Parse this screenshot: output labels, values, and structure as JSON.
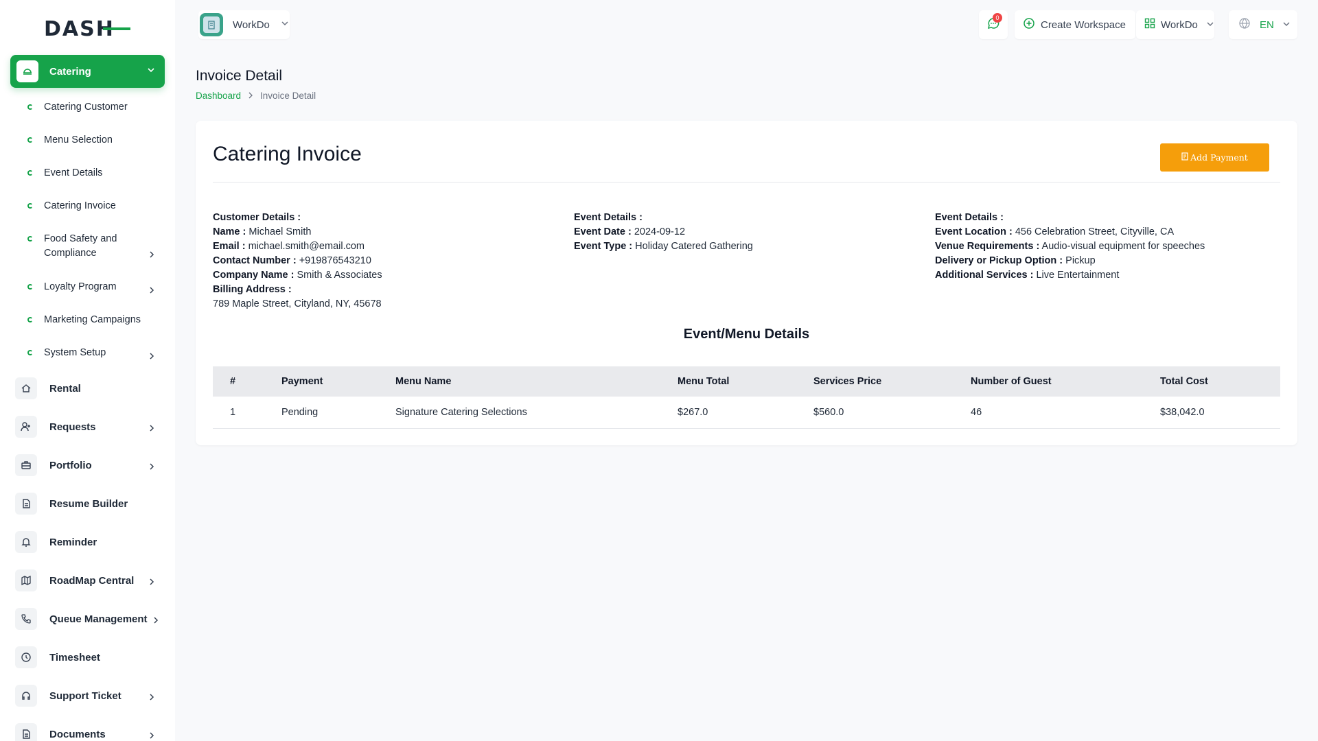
{
  "brand": {
    "logo_text": "DASH",
    "accent": "#16a34a"
  },
  "header": {
    "workspace_name": "WorkDo",
    "notification_count": "0",
    "create_workspace_label": "Create Workspace",
    "workspace_switch_label": "WorkDo",
    "language": "EN"
  },
  "sidebar": {
    "active_group": "Catering",
    "sub_items": [
      {
        "label": "Catering Customer"
      },
      {
        "label": "Menu Selection"
      },
      {
        "label": "Event Details"
      },
      {
        "label": "Catering Invoice"
      },
      {
        "label": "Food Safety and Compliance"
      },
      {
        "label": "Loyalty Program"
      },
      {
        "label": "Marketing Campaigns"
      },
      {
        "label": "System Setup"
      }
    ],
    "main_items": [
      {
        "label": "Rental"
      },
      {
        "label": "Requests"
      },
      {
        "label": "Portfolio"
      },
      {
        "label": "Resume Builder"
      },
      {
        "label": "Reminder"
      },
      {
        "label": "RoadMap Central"
      },
      {
        "label": "Queue Management"
      },
      {
        "label": "Timesheet"
      },
      {
        "label": "Support Ticket"
      },
      {
        "label": "Documents"
      }
    ]
  },
  "page": {
    "title": "Invoice Detail",
    "breadcrumb_home": "Dashboard",
    "breadcrumb_current": "Invoice Detail"
  },
  "invoice": {
    "title": "Catering Invoice",
    "add_payment_label": "Add Payment",
    "customer": {
      "heading": "Customer Details :",
      "name_label": "Name :",
      "name": "Michael Smith",
      "email_label": "Email :",
      "email": "michael.smith@email.com",
      "contact_label": "Contact Number :",
      "contact": "+919876543210",
      "company_label": "Company Name :",
      "company": "Smith & Associates",
      "billing_label": "Billing Address :",
      "billing": "789 Maple Street, Cityland, NY, 45678"
    },
    "event": {
      "heading": "Event Details :",
      "date_label": "Event Date :",
      "date": "2024-09-12",
      "type_label": "Event Type :",
      "type": "Holiday Catered Gathering"
    },
    "event_more": {
      "heading": "Event Details :",
      "location_label": "Event Location :",
      "location": "456 Celebration Street, Cityville, CA",
      "venue_label": "Venue Requirements :",
      "venue": "Audio-visual equipment for speeches",
      "delivery_label": "Delivery or Pickup Option :",
      "delivery": "Pickup",
      "services_label": "Additional Services :",
      "services": "Live Entertainment"
    },
    "section_title": "Event/Menu Details",
    "columns": [
      "#",
      "Payment",
      "Menu Name",
      "Menu Total",
      "Services Price",
      "Number of Guest",
      "Total Cost"
    ],
    "rows": [
      {
        "num": "1",
        "payment": "Pending",
        "menu_name": "Signature Catering Selections",
        "menu_total": "$267.0",
        "services_price": "$560.0",
        "guests": "46",
        "total_cost": "$38,042.0"
      }
    ],
    "status_color": "#f59e0b"
  }
}
